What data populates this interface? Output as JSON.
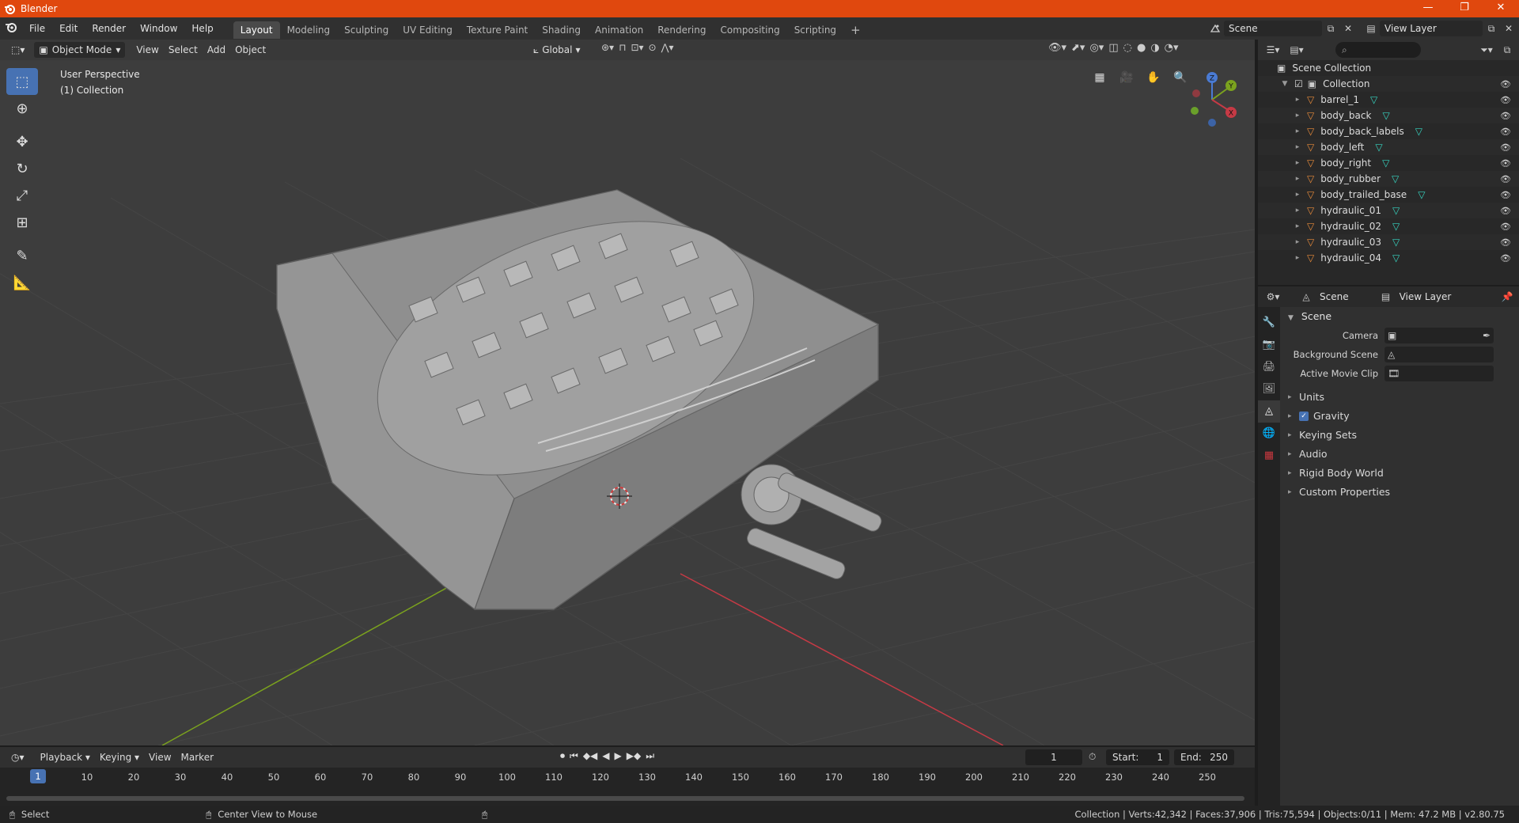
{
  "window": {
    "title": "Blender",
    "controls": [
      "—",
      "❐",
      "✕"
    ]
  },
  "topbar": {
    "menus": [
      "File",
      "Edit",
      "Render",
      "Window",
      "Help"
    ],
    "workspaces": [
      "Layout",
      "Modeling",
      "Sculpting",
      "UV Editing",
      "Texture Paint",
      "Shading",
      "Animation",
      "Rendering",
      "Compositing",
      "Scripting"
    ],
    "active_workspace": "Layout",
    "add_tab": "+",
    "scene_name": "Scene",
    "view_layer_name": "View Layer"
  },
  "viewport": {
    "mode": "Object Mode",
    "menus": [
      "View",
      "Select",
      "Add",
      "Object"
    ],
    "transform_orientation": "Global",
    "perspective_label": "User Perspective",
    "collection_label": "(1) Collection"
  },
  "outliner": {
    "root": "Scene Collection",
    "collection": "Collection",
    "objects": [
      "barrel_1",
      "body_back",
      "body_back_labels",
      "body_left",
      "body_right",
      "body_rubber",
      "body_trailed_base",
      "hydraulic_01",
      "hydraulic_02",
      "hydraulic_03",
      "hydraulic_04"
    ]
  },
  "properties": {
    "header_scene": "Scene",
    "header_view_layer": "View Layer",
    "panel_title": "Scene",
    "fields": [
      {
        "label": "Camera",
        "value": ""
      },
      {
        "label": "Background Scene",
        "value": ""
      },
      {
        "label": "Active Movie Clip",
        "value": ""
      }
    ],
    "subpanels": [
      "Units",
      "Gravity",
      "Keying Sets",
      "Audio",
      "Rigid Body World",
      "Custom Properties"
    ],
    "gravity_enabled": true
  },
  "timeline": {
    "menus": [
      "Playback",
      "Keying",
      "View",
      "Marker"
    ],
    "current_frame": "1",
    "start_label": "Start:",
    "start_value": "1",
    "end_label": "End:",
    "end_value": "250",
    "ruler": [
      "1",
      "10",
      "20",
      "30",
      "40",
      "50",
      "60",
      "70",
      "80",
      "90",
      "100",
      "110",
      "120",
      "130",
      "140",
      "150",
      "160",
      "170",
      "180",
      "190",
      "200",
      "210",
      "220",
      "230",
      "240",
      "250"
    ]
  },
  "statusbar": {
    "left_action": "Select",
    "middle_action": "Center View to Mouse",
    "stats": "Collection | Verts:42,342 | Faces:37,906 | Tris:75,594 | Objects:0/11 | Mem: 47.2 MB | v2.80.75"
  },
  "colors": {
    "title_bar": "#e0480e",
    "accent": "#4772b3",
    "object_icon": "#e98b3a",
    "mesh_icon": "#37d6c2",
    "axis_x": "#c63a45",
    "axis_y": "#7ba21e"
  }
}
